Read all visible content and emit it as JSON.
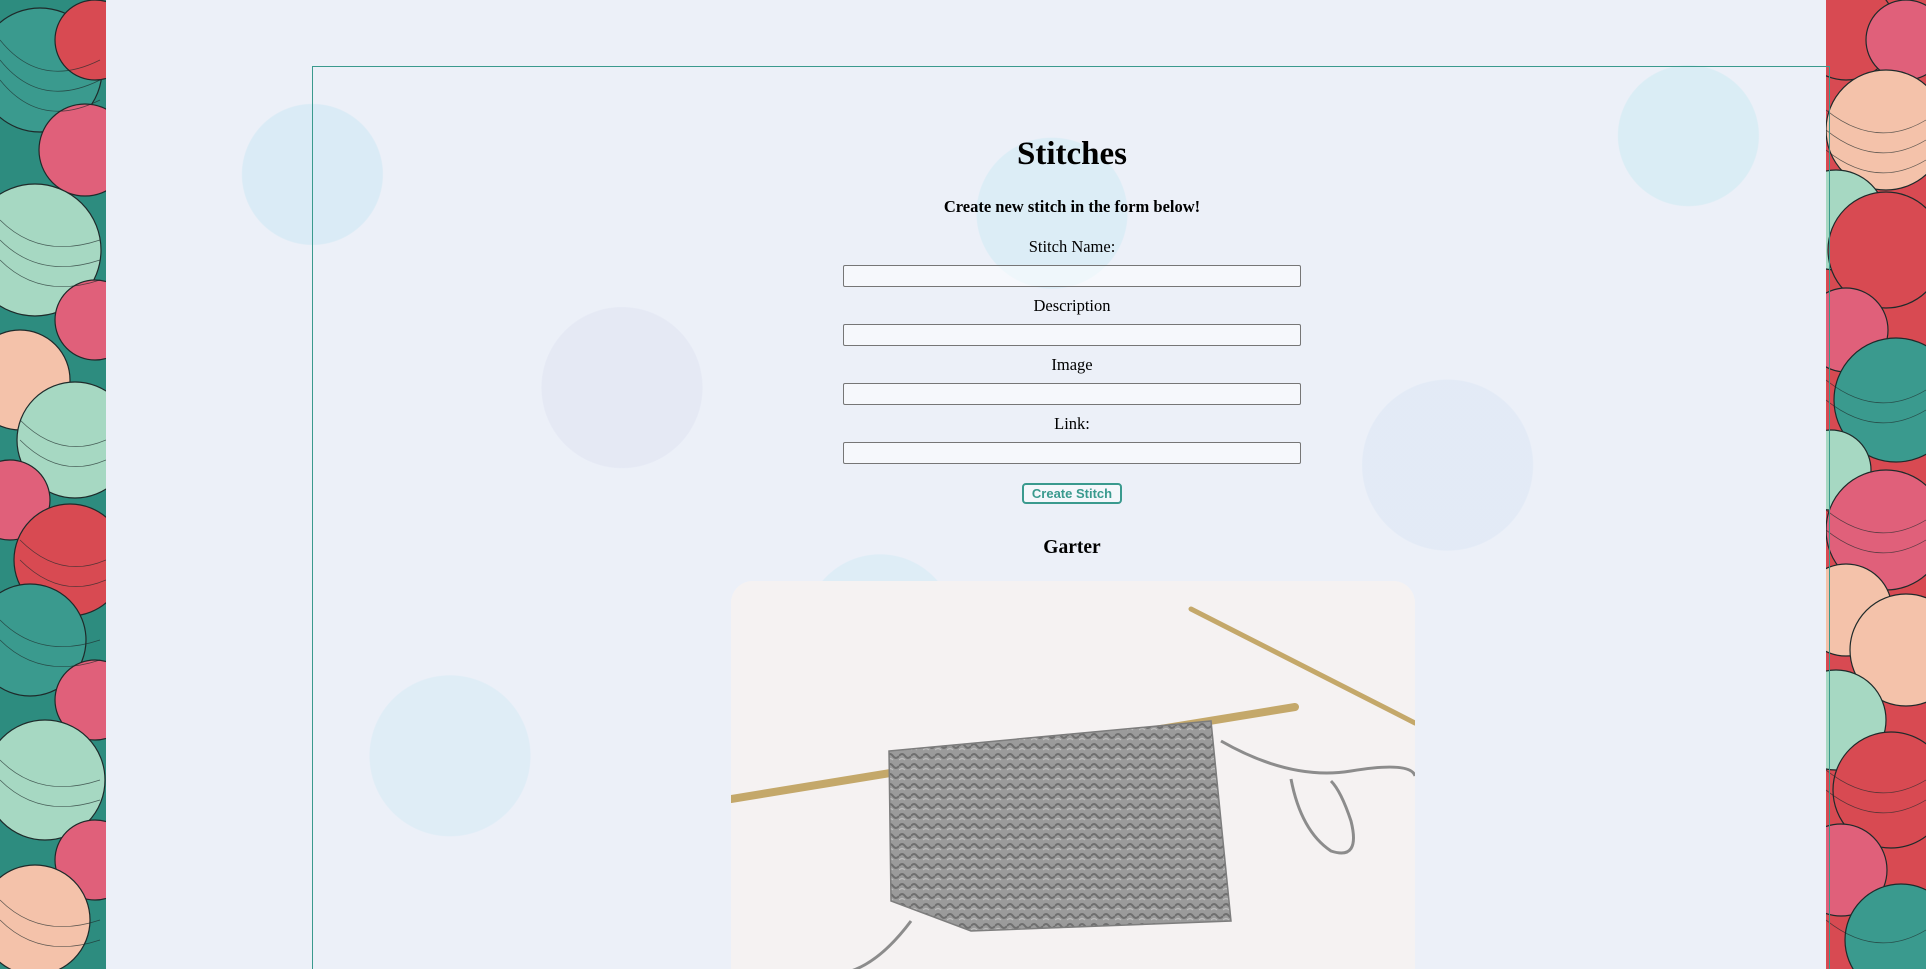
{
  "header": {
    "title": "Stitches",
    "subtitle": "Create new stitch in the form below!"
  },
  "form": {
    "fields": [
      {
        "label": "Stitch Name:",
        "value": "",
        "placeholder": ""
      },
      {
        "label": "Description",
        "value": "",
        "placeholder": ""
      },
      {
        "label": "Image",
        "value": "",
        "placeholder": ""
      },
      {
        "label": "Link:",
        "value": "",
        "placeholder": ""
      }
    ],
    "submit_label": "Create Stitch"
  },
  "stitches": [
    {
      "name": "Garter",
      "image_subject": "garter-stitch-knitting-swatch"
    }
  ],
  "colors": {
    "accent": "#3a9a8e",
    "panel_background": "#ecf0f8",
    "yarn_teal": "#3a9a8e",
    "yarn_pink": "#e0607a",
    "yarn_red": "#d84a52",
    "yarn_mint": "#a6d8c2",
    "yarn_peach": "#f4c2aa"
  }
}
